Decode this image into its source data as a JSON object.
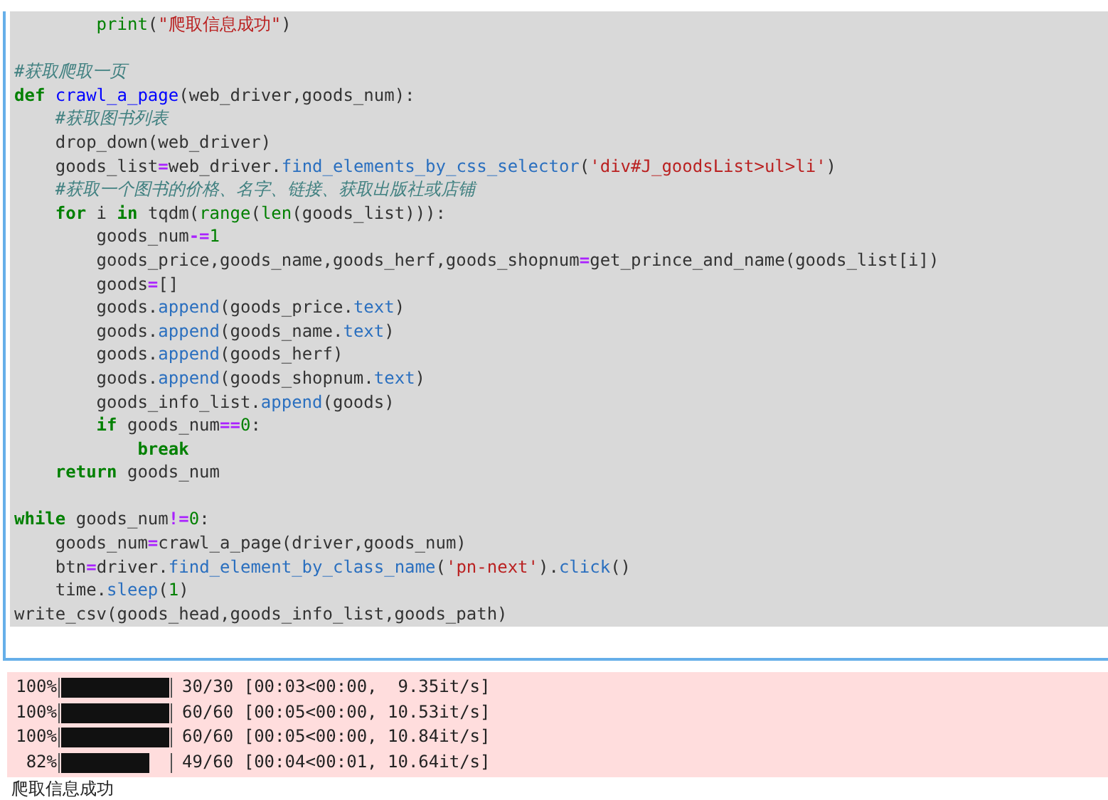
{
  "code_cell": {
    "lines": [
      {
        "kind": "code",
        "tokens": [
          {
            "kind": "builtin",
            "text": "        print"
          },
          {
            "kind": "plain",
            "text": "("
          },
          {
            "kind": "str",
            "text": "\"爬取信息成功\""
          },
          {
            "kind": "plain",
            "text": ")"
          }
        ]
      },
      {
        "kind": "blank"
      },
      {
        "kind": "code",
        "tokens": [
          {
            "kind": "comment",
            "text": "#获取爬取一页"
          }
        ]
      },
      {
        "kind": "code",
        "tokens": [
          {
            "kind": "kw",
            "text": "def"
          },
          {
            "kind": "fn",
            "text": " crawl_a_page"
          },
          {
            "kind": "plain",
            "text": "(web_driver,goods_num):"
          }
        ]
      },
      {
        "kind": "code",
        "tokens": [
          {
            "kind": "comment",
            "text": "    #获取图书列表"
          }
        ]
      },
      {
        "kind": "code",
        "tokens": [
          {
            "kind": "plain",
            "text": "    drop_down(web_driver)"
          }
        ]
      },
      {
        "kind": "code",
        "tokens": [
          {
            "kind": "plain",
            "text": "    goods_list"
          },
          {
            "kind": "op",
            "text": "="
          },
          {
            "kind": "plain",
            "text": "web_driver."
          },
          {
            "kind": "attr",
            "text": "find_elements_by_css_selector"
          },
          {
            "kind": "plain",
            "text": "("
          },
          {
            "kind": "str",
            "text": "'div#J_goodsList>ul>li'"
          },
          {
            "kind": "plain",
            "text": ")"
          }
        ]
      },
      {
        "kind": "code",
        "tokens": [
          {
            "kind": "comment",
            "text": "    #获取一个图书的价格、名字、链接、获取出版社或店铺"
          }
        ]
      },
      {
        "kind": "code",
        "tokens": [
          {
            "kind": "kw",
            "text": "    for"
          },
          {
            "kind": "plain",
            "text": " i "
          },
          {
            "kind": "kw",
            "text": "in"
          },
          {
            "kind": "plain",
            "text": " tqdm("
          },
          {
            "kind": "builtin",
            "text": "range"
          },
          {
            "kind": "plain",
            "text": "("
          },
          {
            "kind": "builtin",
            "text": "len"
          },
          {
            "kind": "plain",
            "text": "(goods_list))):"
          }
        ]
      },
      {
        "kind": "code",
        "tokens": [
          {
            "kind": "plain",
            "text": "        goods_num"
          },
          {
            "kind": "op",
            "text": "-="
          },
          {
            "kind": "num",
            "text": "1"
          }
        ]
      },
      {
        "kind": "code",
        "tokens": [
          {
            "kind": "plain",
            "text": "        goods_price,goods_name,goods_herf,goods_shopnum"
          },
          {
            "kind": "op",
            "text": "="
          },
          {
            "kind": "plain",
            "text": "get_prince_and_name(goods_list[i])"
          }
        ]
      },
      {
        "kind": "code",
        "tokens": [
          {
            "kind": "plain",
            "text": "        goods"
          },
          {
            "kind": "op",
            "text": "="
          },
          {
            "kind": "plain",
            "text": "[]"
          }
        ]
      },
      {
        "kind": "code",
        "tokens": [
          {
            "kind": "plain",
            "text": "        goods."
          },
          {
            "kind": "attr",
            "text": "append"
          },
          {
            "kind": "plain",
            "text": "(goods_price."
          },
          {
            "kind": "attr",
            "text": "text"
          },
          {
            "kind": "plain",
            "text": ")"
          }
        ]
      },
      {
        "kind": "code",
        "tokens": [
          {
            "kind": "plain",
            "text": "        goods."
          },
          {
            "kind": "attr",
            "text": "append"
          },
          {
            "kind": "plain",
            "text": "(goods_name."
          },
          {
            "kind": "attr",
            "text": "text"
          },
          {
            "kind": "plain",
            "text": ")"
          }
        ]
      },
      {
        "kind": "code",
        "tokens": [
          {
            "kind": "plain",
            "text": "        goods."
          },
          {
            "kind": "attr",
            "text": "append"
          },
          {
            "kind": "plain",
            "text": "(goods_herf)"
          }
        ]
      },
      {
        "kind": "code",
        "tokens": [
          {
            "kind": "plain",
            "text": "        goods."
          },
          {
            "kind": "attr",
            "text": "append"
          },
          {
            "kind": "plain",
            "text": "(goods_shopnum."
          },
          {
            "kind": "attr",
            "text": "text"
          },
          {
            "kind": "plain",
            "text": ")"
          }
        ]
      },
      {
        "kind": "code",
        "tokens": [
          {
            "kind": "plain",
            "text": "        goods_info_list."
          },
          {
            "kind": "attr",
            "text": "append"
          },
          {
            "kind": "plain",
            "text": "(goods)"
          }
        ]
      },
      {
        "kind": "code",
        "tokens": [
          {
            "kind": "kw",
            "text": "        if"
          },
          {
            "kind": "plain",
            "text": " goods_num"
          },
          {
            "kind": "op",
            "text": "=="
          },
          {
            "kind": "num",
            "text": "0"
          },
          {
            "kind": "plain",
            "text": ":"
          }
        ]
      },
      {
        "kind": "code",
        "tokens": [
          {
            "kind": "kw",
            "text": "            break"
          }
        ]
      },
      {
        "kind": "code",
        "tokens": [
          {
            "kind": "kw",
            "text": "    return"
          },
          {
            "kind": "plain",
            "text": " goods_num"
          }
        ]
      },
      {
        "kind": "blank"
      },
      {
        "kind": "code",
        "tokens": [
          {
            "kind": "kw",
            "text": "while"
          },
          {
            "kind": "plain",
            "text": " goods_num"
          },
          {
            "kind": "op",
            "text": "!="
          },
          {
            "kind": "num",
            "text": "0"
          },
          {
            "kind": "plain",
            "text": ":"
          }
        ]
      },
      {
        "kind": "code",
        "tokens": [
          {
            "kind": "plain",
            "text": "    goods_num"
          },
          {
            "kind": "op",
            "text": "="
          },
          {
            "kind": "plain",
            "text": "crawl_a_page(driver,goods_num)"
          }
        ]
      },
      {
        "kind": "code",
        "tokens": [
          {
            "kind": "plain",
            "text": "    btn"
          },
          {
            "kind": "op",
            "text": "="
          },
          {
            "kind": "plain",
            "text": "driver."
          },
          {
            "kind": "attr",
            "text": "find_element_by_class_name"
          },
          {
            "kind": "plain",
            "text": "("
          },
          {
            "kind": "str",
            "text": "'pn-next'"
          },
          {
            "kind": "plain",
            "text": ")."
          },
          {
            "kind": "attr",
            "text": "click"
          },
          {
            "kind": "plain",
            "text": "()"
          }
        ]
      },
      {
        "kind": "code",
        "tokens": [
          {
            "kind": "plain",
            "text": "    time."
          },
          {
            "kind": "attr",
            "text": "sleep"
          },
          {
            "kind": "plain",
            "text": "("
          },
          {
            "kind": "num",
            "text": "1"
          },
          {
            "kind": "plain",
            "text": ")"
          }
        ]
      },
      {
        "kind": "code",
        "tokens": [
          {
            "kind": "plain",
            "text": "write_csv(goods_head,goods_info_list,goods_path)"
          }
        ]
      }
    ]
  },
  "output": {
    "progress": [
      {
        "percent": "100%",
        "level": 1,
        "stats": "30/30 [00:03<00:00,  9.35it/s]"
      },
      {
        "percent": "100%",
        "level": 1,
        "stats": "60/60 [00:05<00:00, 10.53it/s]"
      },
      {
        "percent": "100%",
        "level": 1,
        "stats": "60/60 [00:05<00:00, 10.84it/s]"
      },
      {
        "percent": "82%",
        "level": 0.82,
        "stats": "49/60 [00:04<00:01, 10.64it/s]"
      }
    ],
    "stdout": "爬取信息成功"
  }
}
